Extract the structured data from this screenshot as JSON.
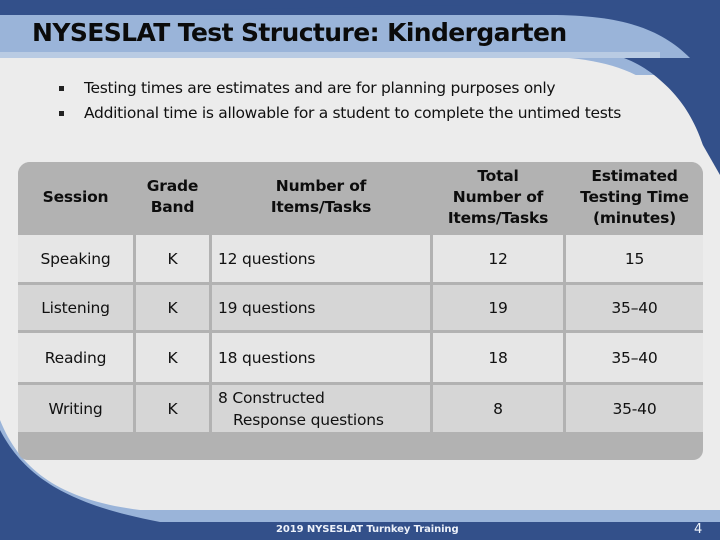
{
  "slide": {
    "title": "NYSESLAT Test Structure: Kindergarten",
    "bullets": [
      "Testing times are estimates and are for planning purposes only",
      "Additional time is allowable for a student to complete the untimed tests"
    ],
    "colors": {
      "dark_blue": "#33508a",
      "light_blue": "#9ab4d9",
      "background": "#ececec",
      "header_gray": "#b2b2b2",
      "row_light": "#e6e6e6",
      "row_dark": "#d6d6d6"
    }
  },
  "table": {
    "headers": [
      "Session",
      "Grade Band",
      "Number of Items/Tasks",
      "Total Number of Items/Tasks",
      "Estimated Testing Time (minutes)"
    ],
    "header_lines": [
      [
        "Session"
      ],
      [
        "Grade",
        "Band"
      ],
      [
        "Number of",
        "Items/Tasks"
      ],
      [
        "Total",
        "Number of",
        "Items/Tasks"
      ],
      [
        "Estimated",
        "Testing Time",
        "(minutes)"
      ]
    ],
    "rows": [
      {
        "session": "Speaking",
        "grade_band": "K",
        "items": "12 questions",
        "total": "12",
        "time": "15"
      },
      {
        "session": "Listening",
        "grade_band": "K",
        "items": "19 questions",
        "total": "19",
        "time": "35–40"
      },
      {
        "session": "Reading",
        "grade_band": "K",
        "items": "18 questions",
        "total": "18",
        "time": "35–40"
      },
      {
        "session": "Writing",
        "grade_band": "K",
        "items_line1": "8 Constructed",
        "items_line2": "Response questions",
        "total": "8",
        "time": "35-40"
      }
    ]
  },
  "footer": {
    "text": "2019 NYSESLAT Turnkey Training",
    "page_number": "4"
  }
}
